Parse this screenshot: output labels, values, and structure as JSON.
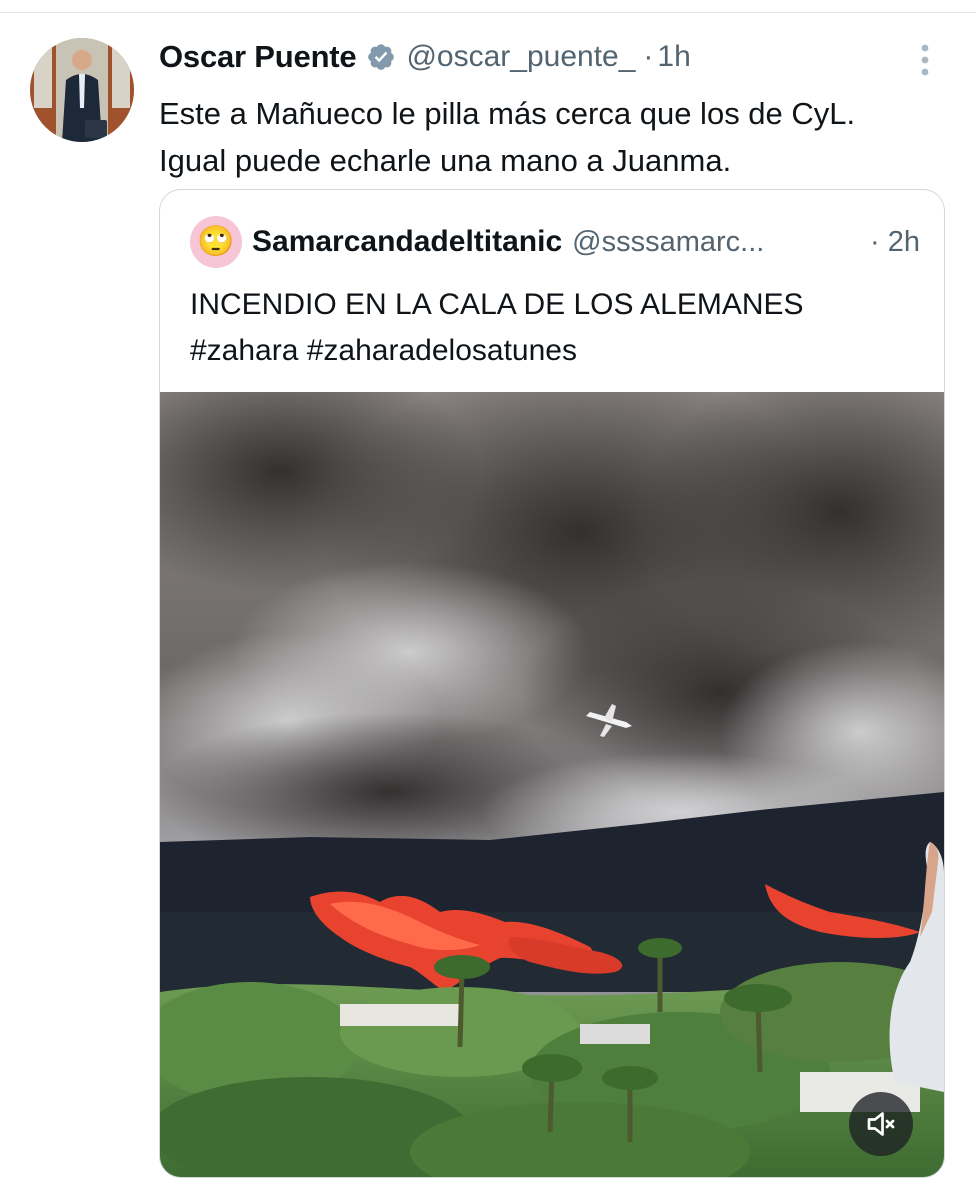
{
  "tweet": {
    "author_name": "Oscar Puente",
    "handle": "@oscar_puente_",
    "separator": "·",
    "time": "1h",
    "text_lines": [
      "Este a Mañueco le pilla más cerca que los de CyL.",
      "Igual puede echarle una mano a Juanma."
    ],
    "verified": true,
    "icons": {
      "verified": "verified-badge-icon",
      "more": "more-vertical-icon"
    }
  },
  "quoted_tweet": {
    "author_name": "Samarcandadeltitanic",
    "handle": "@ssssamarc...",
    "separator": "·",
    "time": "2h",
    "avatar_emoji": "🙄",
    "text_lines": [
      "INCENDIO EN LA CALA DE LOS ALEMANES",
      "#zahara #zaharadelosatunes"
    ],
    "media": {
      "type": "video",
      "muted": true
    }
  },
  "colors": {
    "text_primary": "#0f1419",
    "text_secondary": "#536471",
    "border": "#cfd9de",
    "verified_badge": "#829aab",
    "flame": "#e8432f"
  }
}
